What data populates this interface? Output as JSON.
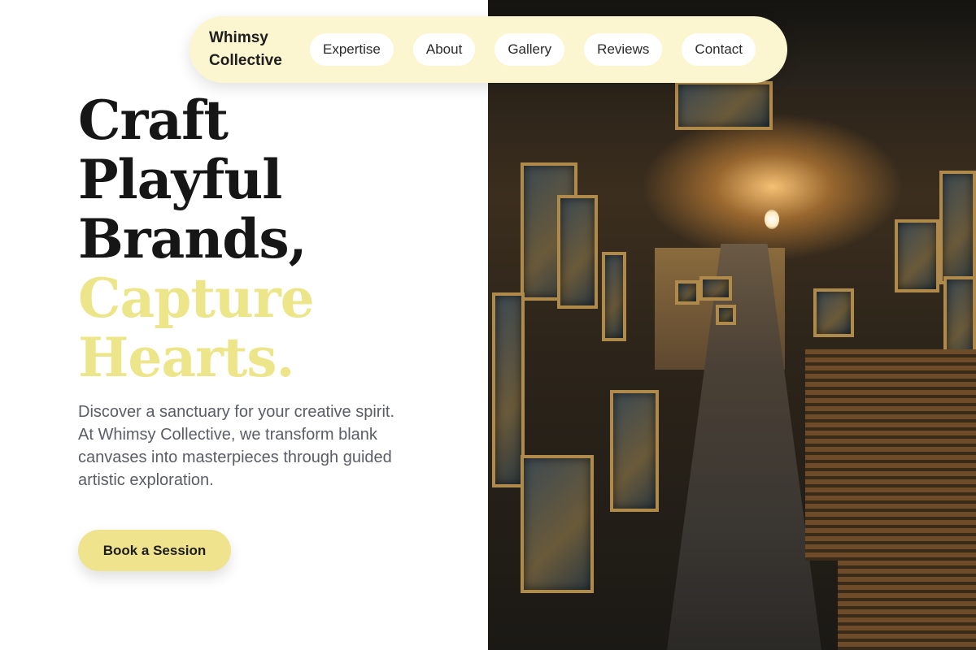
{
  "nav": {
    "brand": [
      "Whimsy",
      "Collective"
    ],
    "links": [
      "Expertise",
      "About",
      "Gallery",
      "Reviews",
      "Contact"
    ]
  },
  "hero": {
    "headline_dark": [
      "Craft",
      "Playful",
      "Brands,"
    ],
    "headline_accent": [
      "Capture",
      "Hearts."
    ],
    "description": "Discover a sanctuary for your creative spirit. At Whimsy Collective, we transform blank canvases into masterpieces through guided artistic exploration.",
    "cta_label": "Book a Session"
  },
  "colors": {
    "accent": "#ece58a",
    "nav_background": "#fbf6cf",
    "button": "#efe38d",
    "text_dark": "#161616"
  },
  "image": {
    "subject": "art-studio-corridor-photo"
  }
}
